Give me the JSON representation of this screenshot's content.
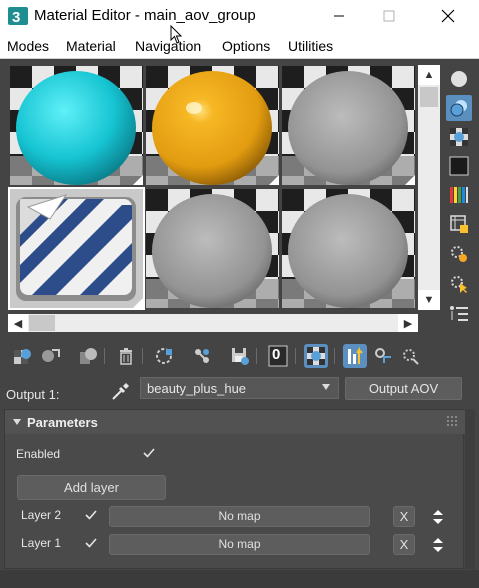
{
  "window": {
    "title": "Material Editor - main_aov_group",
    "app_icon": "3ds-max-icon"
  },
  "menu": {
    "items": [
      "Modes",
      "Material",
      "Navigation",
      "Options",
      "Utilities"
    ]
  },
  "slots": {
    "materials": [
      {
        "name": "cyan-sphere",
        "color": "#19c8d6"
      },
      {
        "name": "orange-sphere",
        "color": "#e8a414"
      },
      {
        "name": "gray-sphere",
        "color": "#9a9a9a"
      },
      {
        "name": "decal-striped",
        "color": "#2c4c8a"
      },
      {
        "name": "gray-sphere",
        "color": "#9a9a9a"
      },
      {
        "name": "gray-sphere",
        "color": "#9a9a9a"
      }
    ],
    "selected_index": 3
  },
  "side_tools": [
    "sample-type-sphere-icon",
    "backlight-icon",
    "background-checker-icon",
    "sample-uv-tiling-icon",
    "video-color-check-icon",
    "make-preview-icon",
    "options-icon",
    "select-by-material-icon",
    "material-map-navigator-icon"
  ],
  "toolbar": {
    "icons": [
      "get-material-icon",
      "put-to-scene-icon",
      "assign-to-selection-icon",
      "delete-icon",
      "make-unique-icon",
      "put-to-library-icon",
      "save-icon",
      "material-id-channel-icon",
      "show-shaded-icon",
      "show-end-result-icon",
      "go-to-parent-icon",
      "go-forward-to-sibling-icon"
    ],
    "material_id": "0"
  },
  "output": {
    "label": "Output 1:",
    "selected": "beauty_plus_hue",
    "button": "Output AOV"
  },
  "parameters": {
    "title": "Parameters",
    "enabled_label": "Enabled",
    "enabled": true,
    "add_layer": "Add layer",
    "layers": [
      {
        "label": "Layer 2",
        "checked": true,
        "map": "No map",
        "clear": "X"
      },
      {
        "label": "Layer 1",
        "checked": true,
        "map": "No map",
        "clear": "X"
      }
    ]
  }
}
